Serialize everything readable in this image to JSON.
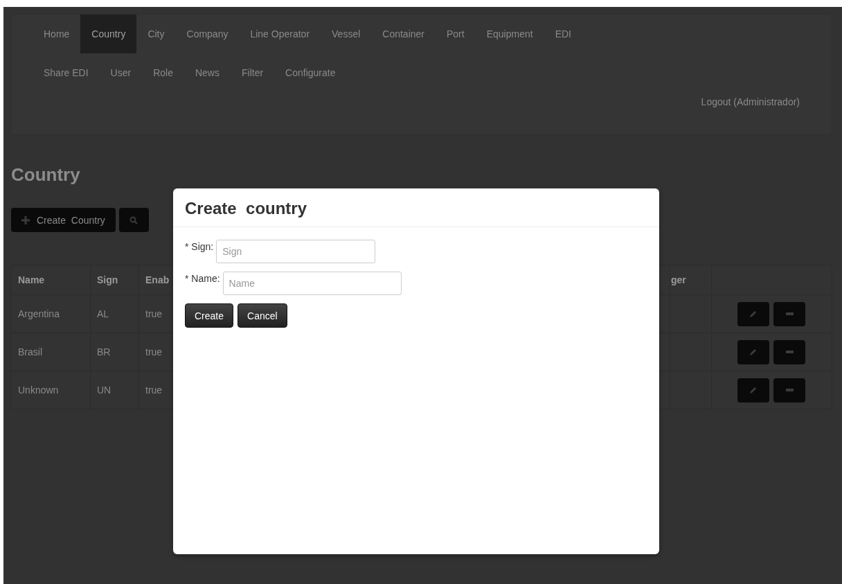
{
  "nav": {
    "items": [
      {
        "label": "Home",
        "selected": false
      },
      {
        "label": "Country",
        "selected": true
      },
      {
        "label": "City",
        "selected": false
      },
      {
        "label": "Company",
        "selected": false
      },
      {
        "label": "Line Operator",
        "selected": false
      },
      {
        "label": "Vessel",
        "selected": false
      },
      {
        "label": "Container",
        "selected": false
      },
      {
        "label": "Port",
        "selected": false
      },
      {
        "label": "Equipment",
        "selected": false
      },
      {
        "label": "EDI",
        "selected": false
      },
      {
        "label": "Share EDI",
        "selected": false
      },
      {
        "label": "User",
        "selected": false
      },
      {
        "label": "Role",
        "selected": false
      },
      {
        "label": "News",
        "selected": false
      },
      {
        "label": "Filter",
        "selected": false
      },
      {
        "label": "Configurate",
        "selected": false
      }
    ],
    "logout": "Logout (Administrador)"
  },
  "page": {
    "title": "Country",
    "create_button": "Create  Country"
  },
  "table": {
    "columns": [
      "Name",
      "Sign",
      "Enab",
      "ger"
    ],
    "rows": [
      {
        "cells": [
          "Argentina",
          "AL",
          "true"
        ]
      },
      {
        "cells": [
          "Brasil",
          "BR",
          "true"
        ]
      },
      {
        "cells": [
          "Unknown",
          "UN",
          "true"
        ]
      }
    ]
  },
  "modal": {
    "title": "Create  country",
    "fields": [
      {
        "label": "* Sign:",
        "placeholder": "Sign"
      },
      {
        "label": "* Name:",
        "placeholder": "Name"
      }
    ],
    "buttons": [
      "Create",
      "Cancel"
    ]
  }
}
